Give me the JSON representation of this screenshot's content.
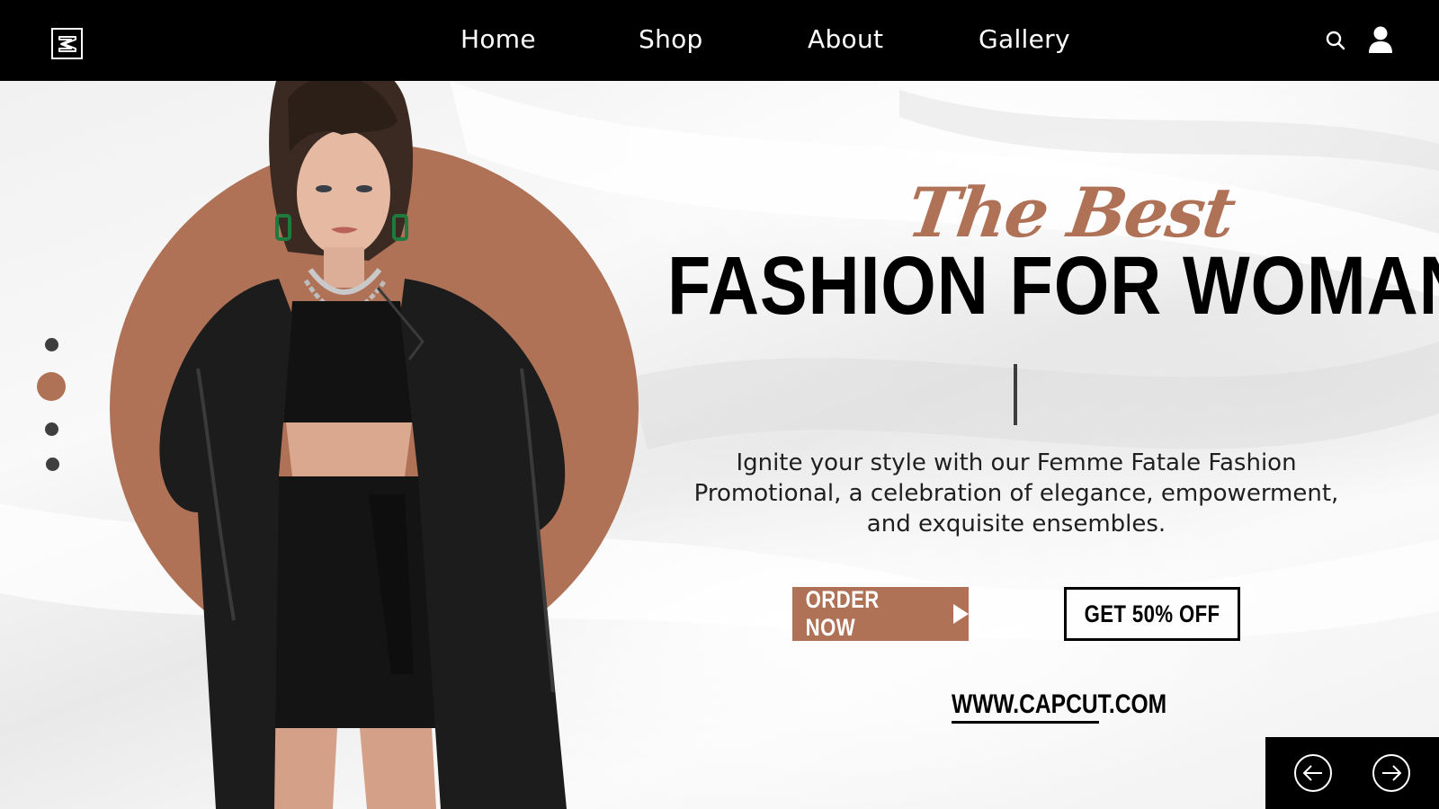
{
  "nav": {
    "items": [
      {
        "label": "Home"
      },
      {
        "label": "Shop"
      },
      {
        "label": "About"
      },
      {
        "label": "Gallery"
      }
    ]
  },
  "hero": {
    "script_title": "The Best",
    "main_title": "FASHION FOR WOMAN",
    "description": "Ignite your style with our Femme Fatale Fashion Promotional, a celebration of elegance, empowerment, and exquisite ensembles.",
    "order_button": "ORDER NOW",
    "offer_button": "GET 50% OFF",
    "website": "WWW.CAPCUT.COM"
  },
  "slider": {
    "dot_count": 4,
    "active_dot": 2
  },
  "colors": {
    "accent": "#b07257",
    "nav_bg": "#000000",
    "text_dark": "#000000"
  },
  "icons": {
    "logo": "capcut-logo-icon",
    "search": "search-icon",
    "user": "user-icon",
    "prev": "arrow-left-circle-icon",
    "next": "arrow-right-circle-icon",
    "play": "play-triangle-icon"
  }
}
